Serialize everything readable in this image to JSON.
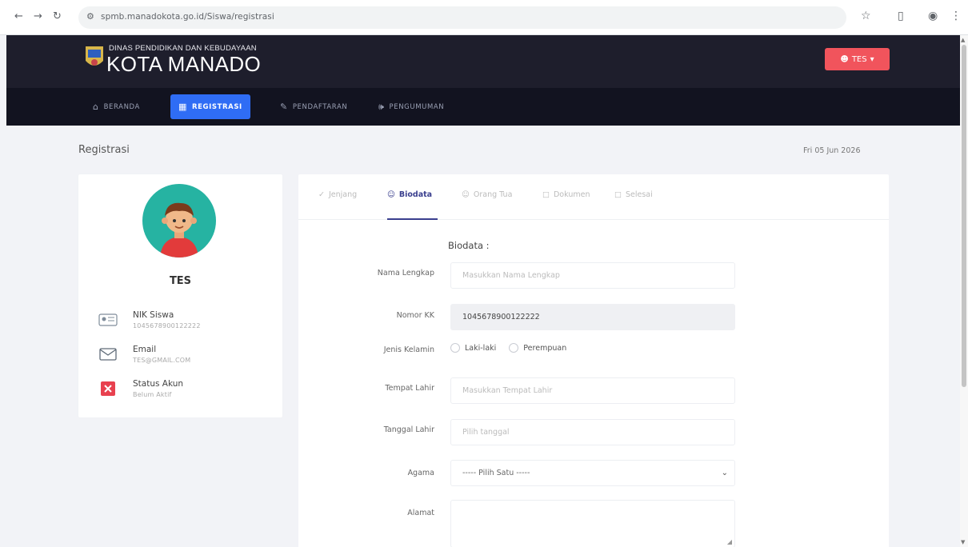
{
  "browser": {
    "back_icon": "arrow-left-icon",
    "forward_icon": "arrow-right-icon",
    "reload_icon": "reload-icon",
    "url": "spmb.manadokota.go.id/Siswa/registrasi",
    "bookmark_icon": "star-icon",
    "extensions_icon": "puzzle-icon",
    "profile_icon": "profile-icon",
    "menu_icon": "kebab-icon"
  },
  "header": {
    "logo_small": "DINAS PENDIDIKAN DAN KEBUDAYAAN",
    "logo_big": "KOTA MANADO",
    "user_button": "TES",
    "colors": {
      "header_bg": "#1e1e2c",
      "navbar_bg": "#121320",
      "accent": "#2f6df5",
      "user_btn": "#f1545c"
    }
  },
  "navbar": {
    "items": [
      {
        "label": "BERANDA",
        "icon": "home-icon",
        "active": false
      },
      {
        "label": "REGISTRASI",
        "icon": "calendar-icon",
        "active": true
      },
      {
        "label": "PENDAFTARAN",
        "icon": "edit-icon",
        "active": false
      },
      {
        "label": "PENGUMUMAN",
        "icon": "megaphone-icon",
        "active": false
      }
    ]
  },
  "page": {
    "title": "Registrasi",
    "date": "Fri 05 Jun 2026"
  },
  "profile": {
    "name": "TES",
    "info": [
      {
        "label": "NIK Siswa",
        "value": "1045678900122222",
        "icon": "id-card-icon"
      },
      {
        "label": "Email",
        "value": "TES@GMAIL.COM",
        "icon": "envelope-icon"
      },
      {
        "label": "Status Akun",
        "value": "Belum Aktif",
        "icon": "x-box-icon"
      }
    ]
  },
  "tabs": [
    {
      "label": "Jenjang",
      "icon": "check-icon",
      "active": false
    },
    {
      "label": "Biodata",
      "icon": "user-icon",
      "active": true
    },
    {
      "label": "Orang Tua",
      "icon": "users-icon",
      "active": false
    },
    {
      "label": "Dokumen",
      "icon": "file-icon",
      "active": false
    },
    {
      "label": "Selesai",
      "icon": "flag-icon",
      "active": false
    }
  ],
  "form": {
    "section_title": "Biodata :",
    "nama_label": "Nama Lengkap",
    "nama_placeholder": "Masukkan Nama Lengkap",
    "nomor_label": "Nomor KK",
    "nomor_value": "1045678900122222",
    "jk_label": "Jenis Kelamin",
    "jk_options": [
      "Laki-laki",
      "Perempuan"
    ],
    "tempat_label": "Tempat Lahir",
    "tempat_placeholder": "Masukkan Tempat Lahir",
    "tanggal_label": "Tanggal Lahir",
    "tanggal_placeholder": "Pilih tanggal",
    "agama_label": "Agama",
    "agama_selected": "----- Pilih Satu -----",
    "alamat_label": "Alamat"
  }
}
